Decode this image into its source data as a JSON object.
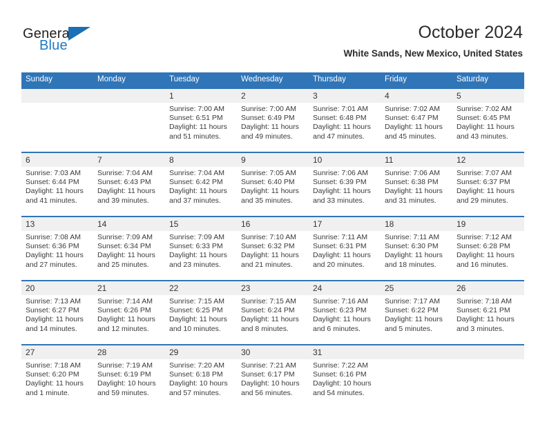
{
  "brand": {
    "name_part1": "General",
    "name_part2": "Blue",
    "accent_color": "#1d7ac4",
    "triangle_icon": "brand-triangle-icon"
  },
  "header": {
    "title": "October 2024",
    "location": "White Sands, New Mexico, United States"
  },
  "theme": {
    "header_blue": "#3075b8",
    "separator_blue": "#2e74b5",
    "daynum_band": "#f0f0f0"
  },
  "weekday_headers": [
    "Sunday",
    "Monday",
    "Tuesday",
    "Wednesday",
    "Thursday",
    "Friday",
    "Saturday"
  ],
  "weeks": [
    [
      {
        "day": "",
        "sunrise": "",
        "sunset": "",
        "daylight": ""
      },
      {
        "day": "",
        "sunrise": "",
        "sunset": "",
        "daylight": ""
      },
      {
        "day": "1",
        "sunrise": "Sunrise: 7:00 AM",
        "sunset": "Sunset: 6:51 PM",
        "daylight": "Daylight: 11 hours and 51 minutes."
      },
      {
        "day": "2",
        "sunrise": "Sunrise: 7:00 AM",
        "sunset": "Sunset: 6:49 PM",
        "daylight": "Daylight: 11 hours and 49 minutes."
      },
      {
        "day": "3",
        "sunrise": "Sunrise: 7:01 AM",
        "sunset": "Sunset: 6:48 PM",
        "daylight": "Daylight: 11 hours and 47 minutes."
      },
      {
        "day": "4",
        "sunrise": "Sunrise: 7:02 AM",
        "sunset": "Sunset: 6:47 PM",
        "daylight": "Daylight: 11 hours and 45 minutes."
      },
      {
        "day": "5",
        "sunrise": "Sunrise: 7:02 AM",
        "sunset": "Sunset: 6:45 PM",
        "daylight": "Daylight: 11 hours and 43 minutes."
      }
    ],
    [
      {
        "day": "6",
        "sunrise": "Sunrise: 7:03 AM",
        "sunset": "Sunset: 6:44 PM",
        "daylight": "Daylight: 11 hours and 41 minutes."
      },
      {
        "day": "7",
        "sunrise": "Sunrise: 7:04 AM",
        "sunset": "Sunset: 6:43 PM",
        "daylight": "Daylight: 11 hours and 39 minutes."
      },
      {
        "day": "8",
        "sunrise": "Sunrise: 7:04 AM",
        "sunset": "Sunset: 6:42 PM",
        "daylight": "Daylight: 11 hours and 37 minutes."
      },
      {
        "day": "9",
        "sunrise": "Sunrise: 7:05 AM",
        "sunset": "Sunset: 6:40 PM",
        "daylight": "Daylight: 11 hours and 35 minutes."
      },
      {
        "day": "10",
        "sunrise": "Sunrise: 7:06 AM",
        "sunset": "Sunset: 6:39 PM",
        "daylight": "Daylight: 11 hours and 33 minutes."
      },
      {
        "day": "11",
        "sunrise": "Sunrise: 7:06 AM",
        "sunset": "Sunset: 6:38 PM",
        "daylight": "Daylight: 11 hours and 31 minutes."
      },
      {
        "day": "12",
        "sunrise": "Sunrise: 7:07 AM",
        "sunset": "Sunset: 6:37 PM",
        "daylight": "Daylight: 11 hours and 29 minutes."
      }
    ],
    [
      {
        "day": "13",
        "sunrise": "Sunrise: 7:08 AM",
        "sunset": "Sunset: 6:36 PM",
        "daylight": "Daylight: 11 hours and 27 minutes."
      },
      {
        "day": "14",
        "sunrise": "Sunrise: 7:09 AM",
        "sunset": "Sunset: 6:34 PM",
        "daylight": "Daylight: 11 hours and 25 minutes."
      },
      {
        "day": "15",
        "sunrise": "Sunrise: 7:09 AM",
        "sunset": "Sunset: 6:33 PM",
        "daylight": "Daylight: 11 hours and 23 minutes."
      },
      {
        "day": "16",
        "sunrise": "Sunrise: 7:10 AM",
        "sunset": "Sunset: 6:32 PM",
        "daylight": "Daylight: 11 hours and 21 minutes."
      },
      {
        "day": "17",
        "sunrise": "Sunrise: 7:11 AM",
        "sunset": "Sunset: 6:31 PM",
        "daylight": "Daylight: 11 hours and 20 minutes."
      },
      {
        "day": "18",
        "sunrise": "Sunrise: 7:11 AM",
        "sunset": "Sunset: 6:30 PM",
        "daylight": "Daylight: 11 hours and 18 minutes."
      },
      {
        "day": "19",
        "sunrise": "Sunrise: 7:12 AM",
        "sunset": "Sunset: 6:28 PM",
        "daylight": "Daylight: 11 hours and 16 minutes."
      }
    ],
    [
      {
        "day": "20",
        "sunrise": "Sunrise: 7:13 AM",
        "sunset": "Sunset: 6:27 PM",
        "daylight": "Daylight: 11 hours and 14 minutes."
      },
      {
        "day": "21",
        "sunrise": "Sunrise: 7:14 AM",
        "sunset": "Sunset: 6:26 PM",
        "daylight": "Daylight: 11 hours and 12 minutes."
      },
      {
        "day": "22",
        "sunrise": "Sunrise: 7:15 AM",
        "sunset": "Sunset: 6:25 PM",
        "daylight": "Daylight: 11 hours and 10 minutes."
      },
      {
        "day": "23",
        "sunrise": "Sunrise: 7:15 AM",
        "sunset": "Sunset: 6:24 PM",
        "daylight": "Daylight: 11 hours and 8 minutes."
      },
      {
        "day": "24",
        "sunrise": "Sunrise: 7:16 AM",
        "sunset": "Sunset: 6:23 PM",
        "daylight": "Daylight: 11 hours and 6 minutes."
      },
      {
        "day": "25",
        "sunrise": "Sunrise: 7:17 AM",
        "sunset": "Sunset: 6:22 PM",
        "daylight": "Daylight: 11 hours and 5 minutes."
      },
      {
        "day": "26",
        "sunrise": "Sunrise: 7:18 AM",
        "sunset": "Sunset: 6:21 PM",
        "daylight": "Daylight: 11 hours and 3 minutes."
      }
    ],
    [
      {
        "day": "27",
        "sunrise": "Sunrise: 7:18 AM",
        "sunset": "Sunset: 6:20 PM",
        "daylight": "Daylight: 11 hours and 1 minute."
      },
      {
        "day": "28",
        "sunrise": "Sunrise: 7:19 AM",
        "sunset": "Sunset: 6:19 PM",
        "daylight": "Daylight: 10 hours and 59 minutes."
      },
      {
        "day": "29",
        "sunrise": "Sunrise: 7:20 AM",
        "sunset": "Sunset: 6:18 PM",
        "daylight": "Daylight: 10 hours and 57 minutes."
      },
      {
        "day": "30",
        "sunrise": "Sunrise: 7:21 AM",
        "sunset": "Sunset: 6:17 PM",
        "daylight": "Daylight: 10 hours and 56 minutes."
      },
      {
        "day": "31",
        "sunrise": "Sunrise: 7:22 AM",
        "sunset": "Sunset: 6:16 PM",
        "daylight": "Daylight: 10 hours and 54 minutes."
      },
      {
        "day": "",
        "sunrise": "",
        "sunset": "",
        "daylight": ""
      },
      {
        "day": "",
        "sunrise": "",
        "sunset": "",
        "daylight": ""
      }
    ]
  ]
}
